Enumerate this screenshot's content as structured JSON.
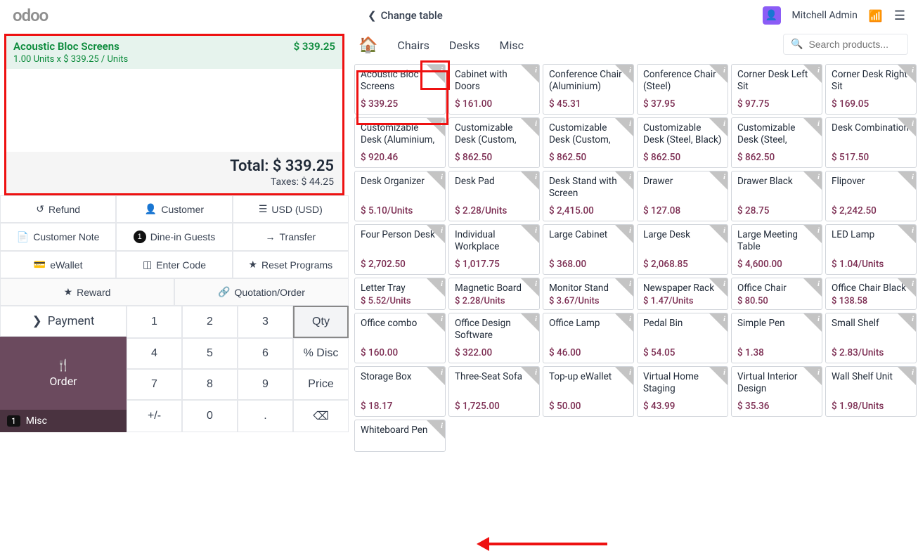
{
  "topbar": {
    "logo": "odoo",
    "change_table": "Change table",
    "user": "Mitchell Admin"
  },
  "order": {
    "line_title": "Acoustic Bloc Screens",
    "line_price": "$ 339.25",
    "line_sub": "1.00  Units x $ 339.25 / Units",
    "total_label": "Total: $ 339.25",
    "taxes_label": "Taxes: $ 44.25"
  },
  "buttons": {
    "refund": "Refund",
    "customer": "Customer",
    "usd": "USD (USD)",
    "note": "Customer Note",
    "dinein": "Dine-in Guests",
    "dinein_count": "1",
    "transfer": "Transfer",
    "ewallet": "eWallet",
    "enter_code": "Enter Code",
    "reset_programs": "Reset Programs",
    "reward": "Reward",
    "quotation": "Quotation/Order",
    "payment": "Payment",
    "order": "Order",
    "order_sub_label": "Misc",
    "order_sub_count": "1"
  },
  "numpad": {
    "k1": "1",
    "k2": "2",
    "k3": "3",
    "qty": "Qty",
    "k4": "4",
    "k5": "5",
    "k6": "6",
    "disc": "% Disc",
    "k7": "7",
    "k8": "8",
    "k9": "9",
    "price": "Price",
    "pm": "+/-",
    "k0": "0",
    "dot": ".",
    "bs": "⌫"
  },
  "categories": {
    "chairs": "Chairs",
    "desks": "Desks",
    "misc": "Misc"
  },
  "search": {
    "placeholder": "Search products..."
  },
  "products": [
    {
      "name": "Acoustic Bloc Screens",
      "price": "$ 339.25"
    },
    {
      "name": "Cabinet with Doors",
      "price": "$ 161.00"
    },
    {
      "name": "Conference Chair (Aluminium)",
      "price": "$ 45.31"
    },
    {
      "name": "Conference Chair (Steel)",
      "price": "$ 37.95"
    },
    {
      "name": "Corner Desk Left Sit",
      "price": "$ 97.75"
    },
    {
      "name": "Corner Desk Right Sit",
      "price": "$ 169.05"
    },
    {
      "name": "Customizable Desk (Aluminium, White)",
      "price": "$ 920.46"
    },
    {
      "name": "Customizable Desk (Custom, Black)",
      "price": "$ 862.50"
    },
    {
      "name": "Customizable Desk (Custom, White)",
      "price": "$ 862.50"
    },
    {
      "name": "Customizable Desk (Steel, Black)",
      "price": "$ 862.50"
    },
    {
      "name": "Customizable Desk (Steel, White)",
      "price": "$ 862.50"
    },
    {
      "name": "Desk Combination",
      "price": "$ 517.50"
    },
    {
      "name": "Desk Organizer",
      "price": "$ 5.10/Units"
    },
    {
      "name": "Desk Pad",
      "price": "$ 2.28/Units"
    },
    {
      "name": "Desk Stand with Screen",
      "price": "$ 2,415.00"
    },
    {
      "name": "Drawer",
      "price": "$ 127.08"
    },
    {
      "name": "Drawer Black",
      "price": "$ 28.75"
    },
    {
      "name": "Flipover",
      "price": "$ 2,242.50"
    },
    {
      "name": "Four Person Desk",
      "price": "$ 2,702.50"
    },
    {
      "name": "Individual Workplace",
      "price": "$ 1,017.75"
    },
    {
      "name": "Large Cabinet",
      "price": "$ 368.00"
    },
    {
      "name": "Large Desk",
      "price": "$ 2,068.85"
    },
    {
      "name": "Large Meeting Table",
      "price": "$ 4,600.00"
    },
    {
      "name": "LED Lamp",
      "price": "$ 1.04/Units"
    },
    {
      "name": "Letter Tray",
      "price": "$ 5.52/Units"
    },
    {
      "name": "Magnetic Board",
      "price": "$ 2.28/Units"
    },
    {
      "name": "Monitor Stand",
      "price": "$ 3.67/Units"
    },
    {
      "name": "Newspaper Rack",
      "price": "$ 1.47/Units"
    },
    {
      "name": "Office Chair",
      "price": "$ 80.50"
    },
    {
      "name": "Office Chair Black",
      "price": "$ 138.58"
    },
    {
      "name": "Office combo",
      "price": "$ 160.00"
    },
    {
      "name": "Office Design Software",
      "price": "$ 322.00"
    },
    {
      "name": "Office Lamp",
      "price": "$ 46.00"
    },
    {
      "name": "Pedal Bin",
      "price": "$ 54.05"
    },
    {
      "name": "Simple Pen",
      "price": "$ 1.38"
    },
    {
      "name": "Small Shelf",
      "price": "$ 2.83/Units"
    },
    {
      "name": "Storage Box",
      "price": "$ 18.17"
    },
    {
      "name": "Three-Seat Sofa",
      "price": "$ 1,725.00"
    },
    {
      "name": "Top-up eWallet",
      "price": "$ 50.00"
    },
    {
      "name": "Virtual Home Staging",
      "price": "$ 43.99"
    },
    {
      "name": "Virtual Interior Design",
      "price": "$ 35.36"
    },
    {
      "name": "Wall Shelf Unit",
      "price": "$ 1.98/Units"
    },
    {
      "name": "Whiteboard Pen",
      "price": ""
    }
  ]
}
